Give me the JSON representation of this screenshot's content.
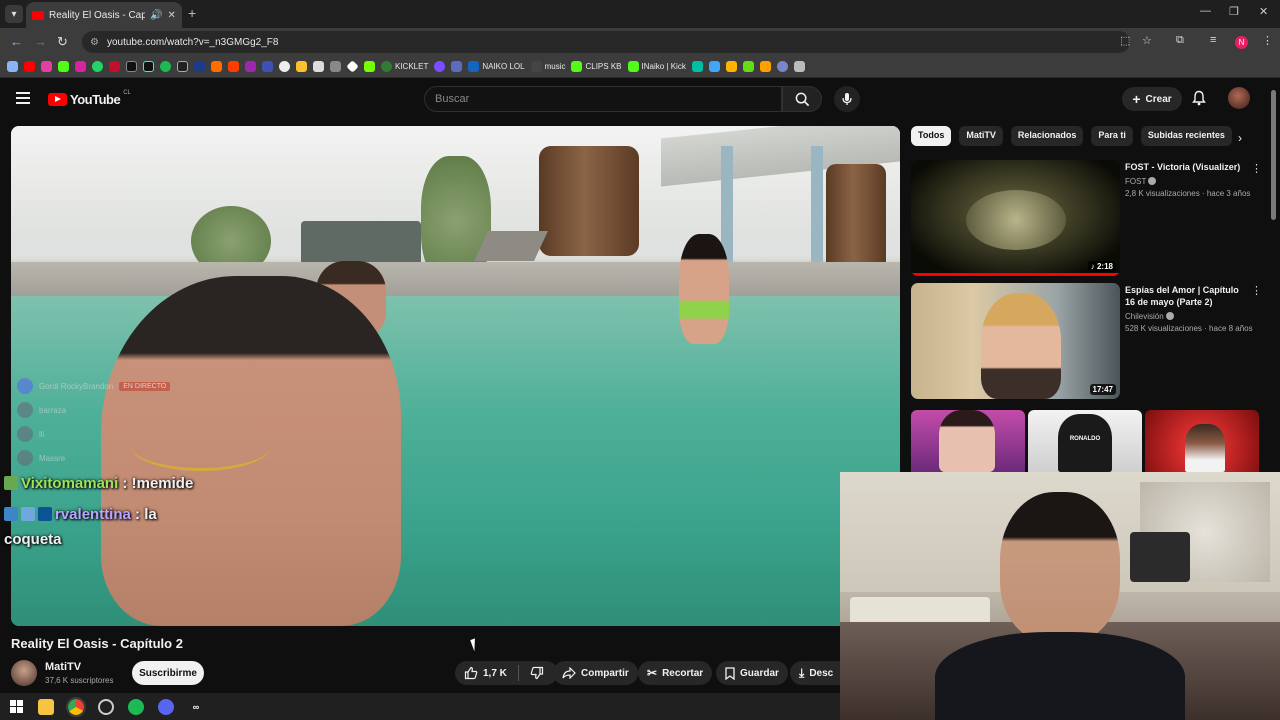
{
  "browser": {
    "tab_title": "Reality El Oasis - Capítulo 2",
    "url": "youtube.com/watch?v=_n3GMGg2_F8",
    "bookmarks": [
      "KICKLET",
      "NAIKO LOL",
      "music",
      "CLIPS KB",
      "INaiko | Kick"
    ],
    "profile_initial": "N"
  },
  "youtube": {
    "logo_text": "YouTube",
    "region": "CL",
    "search_placeholder": "Buscar",
    "create_label": "Crear"
  },
  "video": {
    "title": "Reality El Oasis - Capítulo 2",
    "overlay": {
      "discord_user": "Gordi RockyBrandon",
      "live_badge": "EN DIRECTO",
      "muted_users": [
        "barraza",
        "lli",
        "Massre"
      ]
    },
    "chat": [
      {
        "user": "Vixitomamani",
        "sep": " : ",
        "message": "!memide",
        "user_color": "#9be35a"
      },
      {
        "user": "rvalenttina",
        "sep": " : ",
        "message": "la",
        "continuation": "coqueta",
        "user_color": "#b9a7ff"
      }
    ],
    "channel": {
      "name": "MatiTV",
      "subscribers": "37,6 K suscriptores",
      "subscribe_label": "Suscribirme"
    },
    "actions": {
      "likes": "1,7 K",
      "share": "Compartir",
      "clip": "Recortar",
      "save": "Guardar",
      "download": "Desc"
    }
  },
  "sidebar": {
    "chips": [
      "Todos",
      "MatiTV",
      "Relacionados",
      "Para ti",
      "Subidas recientes"
    ],
    "active_chip": "Todos",
    "videos": [
      {
        "title": "FOST - Victoria (Visualizer)",
        "channel": "FOST",
        "meta": "2,8 K visualizaciones · hace 3 años",
        "duration": "2:18",
        "watched_fraction": 1.0
      },
      {
        "title": "Espías del Amor | Capítulo 16 de mayo (Parte 2)",
        "channel": "Chilevisión",
        "meta": "528 K visualizaciones · hace 8 años",
        "duration": "17:47"
      }
    ],
    "shorts_thumb_text": "RONALDO"
  },
  "colors": {
    "yt_red": "#ff0000",
    "bg": "#0f0f0f",
    "chip_bg": "#272727"
  }
}
